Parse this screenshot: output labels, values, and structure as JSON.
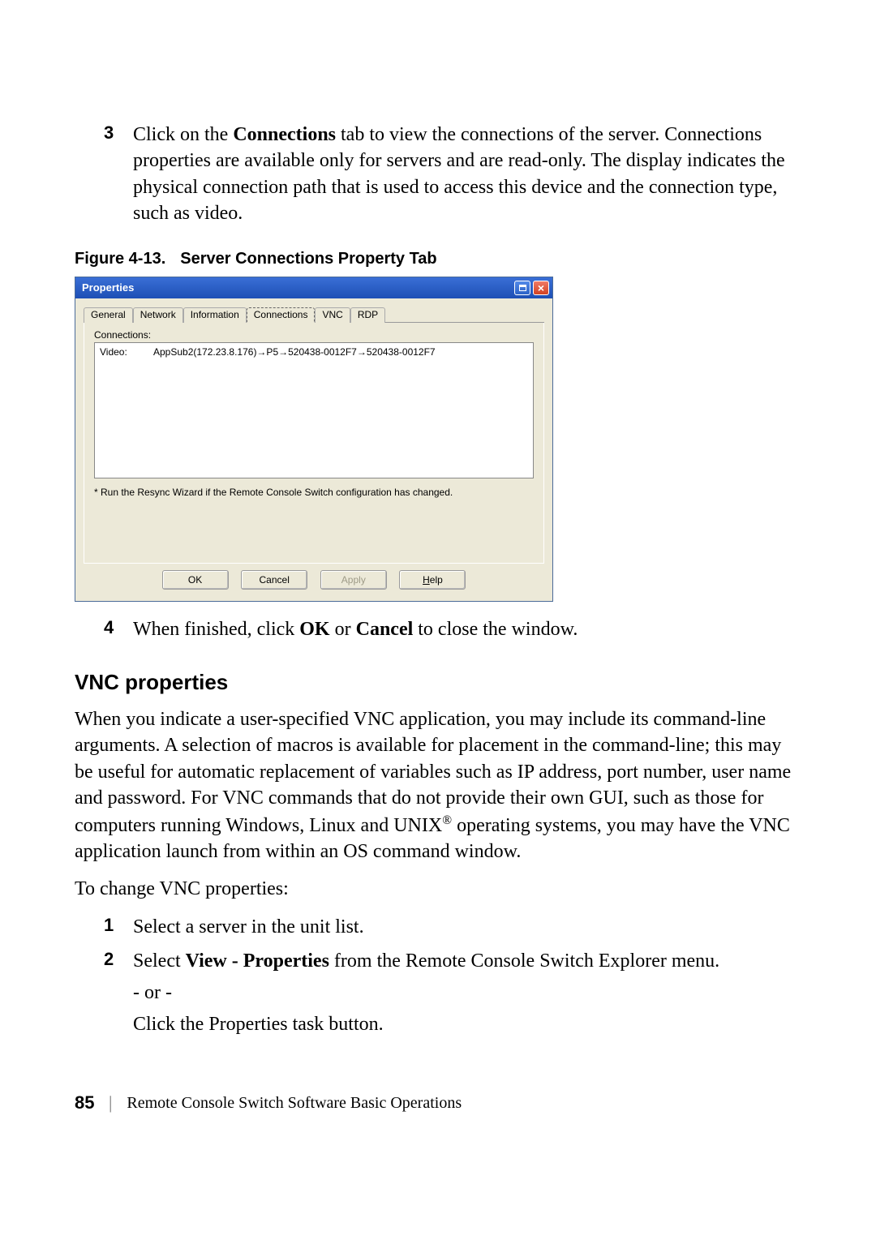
{
  "steps": {
    "step3": {
      "num": "3",
      "pre": "Click on the ",
      "bold1": "Connections",
      "post": " tab to view the connections of the server. Connections properties are available only for servers and are read-only. The display indicates the physical connection path that is used to access this device and the connection type, such as video."
    },
    "step4": {
      "num": "4",
      "pre": "When finished, click ",
      "bold1": "OK",
      "mid": " or ",
      "bold2": "Cancel",
      "post": " to close the window."
    },
    "vnc_step1": {
      "num": "1",
      "text": "Select a server in the unit list."
    },
    "vnc_step2": {
      "num": "2",
      "pre": "Select ",
      "bold1": "View - Properties",
      "post": " from the Remote Console Switch Explorer menu."
    },
    "or": "- or -",
    "step2b": {
      "pre": "Click the ",
      "bold1": "Properties",
      "post": " task button."
    }
  },
  "figure": {
    "num": "Figure 4-13.",
    "title": "Server Connections Property Tab"
  },
  "dialog": {
    "title": "Properties",
    "tabs": {
      "general": "General",
      "network": "Network",
      "information": "Information",
      "connections": "Connections",
      "vnc": "VNC",
      "rdp": "RDP"
    },
    "group_label": "Connections:",
    "row": {
      "label": "Video:",
      "value": "AppSub2(172.23.8.176)→P5→520438-0012F7→520438-0012F7"
    },
    "note": "* Run the Resync Wizard if the Remote Console Switch configuration has changed.",
    "buttons": {
      "ok": "OK",
      "cancel": "Cancel",
      "apply": "Apply",
      "help_pre": "H",
      "help_post": "elp"
    }
  },
  "section": {
    "vnc_title": "VNC properties",
    "vnc_para": "When you indicate a user-specified VNC application, you may include its command-line arguments. A selection of macros is available for placement in the command-line; this may be useful for automatic replacement of variables such as IP address, port number, user name and password. For VNC commands that do not provide their own GUI, such as those for computers running Windows, Linux and UNIX",
    "vnc_para_after_sup": " operating systems, you may have the VNC application launch from within an OS command window.",
    "vnc_lead": "To change VNC properties:"
  },
  "footer": {
    "page": "85",
    "title": "Remote Console Switch Software Basic Operations"
  }
}
